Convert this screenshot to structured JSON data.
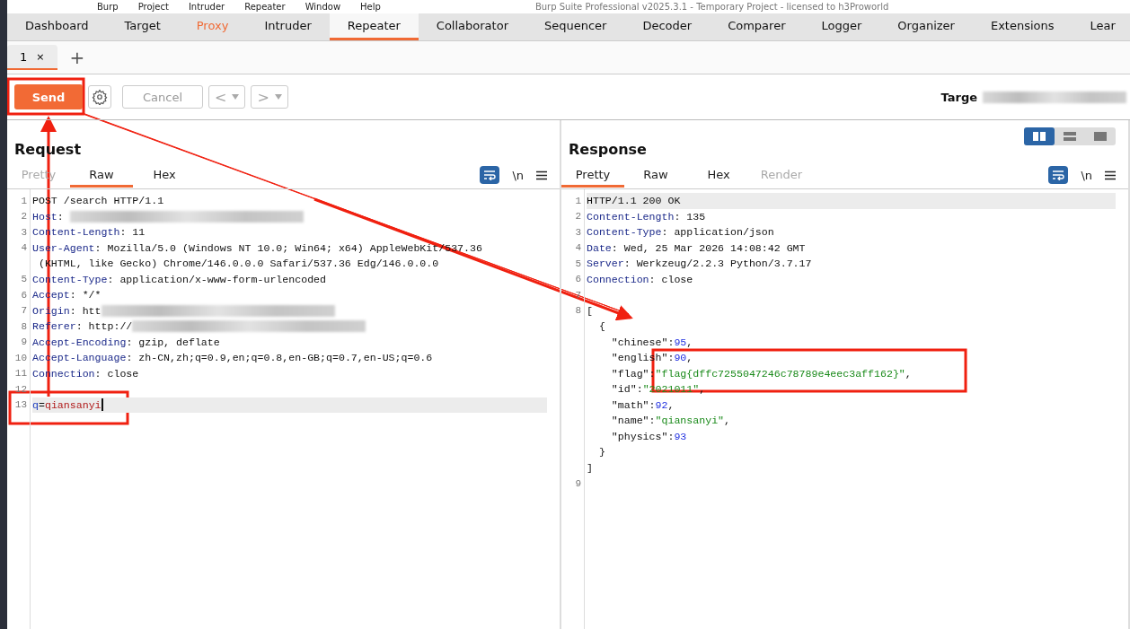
{
  "menu_bar": {
    "items": [
      "Burp",
      "Project",
      "Intruder",
      "Repeater",
      "Window",
      "Help"
    ],
    "title": "Burp Suite Professional v2025.3.1 - Temporary Project - licensed to h3Proworld"
  },
  "tabs": [
    {
      "label": "Dashboard",
      "selected": false,
      "highlighted": false
    },
    {
      "label": "Target",
      "selected": false,
      "highlighted": false
    },
    {
      "label": "Proxy",
      "selected": false,
      "highlighted": true
    },
    {
      "label": "Intruder",
      "selected": false,
      "highlighted": false
    },
    {
      "label": "Repeater",
      "selected": true,
      "highlighted": false
    },
    {
      "label": "Collaborator",
      "selected": false,
      "highlighted": false
    },
    {
      "label": "Sequencer",
      "selected": false,
      "highlighted": false
    },
    {
      "label": "Decoder",
      "selected": false,
      "highlighted": false
    },
    {
      "label": "Comparer",
      "selected": false,
      "highlighted": false
    },
    {
      "label": "Logger",
      "selected": false,
      "highlighted": false
    },
    {
      "label": "Organizer",
      "selected": false,
      "highlighted": false
    },
    {
      "label": "Extensions",
      "selected": false,
      "highlighted": false
    },
    {
      "label": "Lear",
      "selected": false,
      "highlighted": false
    }
  ],
  "repeater_tabs": [
    {
      "label": "1",
      "close": "×",
      "selected": true
    }
  ],
  "add_tab": "+",
  "toolbar": {
    "send": "Send",
    "cancel": "Cancel",
    "back": "<",
    "forward": ">",
    "target_label": "Targe"
  },
  "layout_buttons": [
    {
      "selected": true
    },
    {
      "selected": false
    },
    {
      "selected": false
    }
  ],
  "request": {
    "title": "Request",
    "view_tabs": [
      {
        "label": "Pretty",
        "selected": false,
        "disabled": true
      },
      {
        "label": "Raw",
        "selected": true,
        "disabled": false
      },
      {
        "label": "Hex",
        "selected": false,
        "disabled": false
      }
    ],
    "newline": "\\n",
    "lines": [
      {
        "number": "1",
        "highlighted": false,
        "tokens": [
          {
            "kind": "plain",
            "text": "POST /search HTTP/1.1"
          }
        ]
      },
      {
        "number": "2",
        "highlighted": false,
        "tokens": [
          {
            "kind": "name",
            "text": "Host"
          },
          {
            "kind": "plain",
            "text": ": "
          },
          {
            "kind": "redacted"
          }
        ]
      },
      {
        "number": "3",
        "highlighted": false,
        "tokens": [
          {
            "kind": "name",
            "text": "Content-Length"
          },
          {
            "kind": "plain",
            "text": ": 11"
          }
        ]
      },
      {
        "number": "4",
        "highlighted": false,
        "tokens": [
          {
            "kind": "name",
            "text": "User-Agent"
          },
          {
            "kind": "plain",
            "text": ": Mozilla/5.0 (Windows NT 10.0; Win64; x64) AppleWebKit/537.36"
          }
        ]
      },
      {
        "highlighted": false,
        "tokens": [
          {
            "kind": "plain",
            "text": " (KHTML, like Gecko) Chrome/146.0.0.0 Safari/537.36 Edg/146.0.0.0"
          }
        ]
      },
      {
        "number": "5",
        "highlighted": false,
        "tokens": [
          {
            "kind": "name",
            "text": "Content-Type"
          },
          {
            "kind": "plain",
            "text": ": application/x-www-form-urlencoded"
          }
        ]
      },
      {
        "number": "6",
        "highlighted": false,
        "tokens": [
          {
            "kind": "name",
            "text": "Accept"
          },
          {
            "kind": "plain",
            "text": ": */*"
          }
        ]
      },
      {
        "number": "7",
        "highlighted": false,
        "tokens": [
          {
            "kind": "name",
            "text": "Origin"
          },
          {
            "kind": "plain",
            "text": ": htt"
          },
          {
            "kind": "redacted"
          }
        ]
      },
      {
        "number": "8",
        "highlighted": false,
        "tokens": [
          {
            "kind": "name",
            "text": "Referer"
          },
          {
            "kind": "plain",
            "text": ": http://"
          },
          {
            "kind": "redacted"
          }
        ]
      },
      {
        "number": "9",
        "highlighted": false,
        "tokens": [
          {
            "kind": "name",
            "text": "Accept-Encoding"
          },
          {
            "kind": "plain",
            "text": ": gzip, deflate"
          }
        ]
      },
      {
        "number": "10",
        "highlighted": false,
        "tokens": [
          {
            "kind": "name",
            "text": "Accept-Language"
          },
          {
            "kind": "plain",
            "text": ": zh-CN,zh;q=0.9,en;q=0.8,en-GB;q=0.7,en-US;q=0.6"
          }
        ]
      },
      {
        "number": "11",
        "highlighted": false,
        "tokens": [
          {
            "kind": "name",
            "text": "Connection"
          },
          {
            "kind": "plain",
            "text": ": close"
          }
        ]
      },
      {
        "number": "12",
        "highlighted": false
      },
      {
        "number": "13",
        "highlighted": true,
        "tokens": [
          {
            "kind": "param",
            "text": "q"
          },
          {
            "kind": "plain",
            "text": "="
          },
          {
            "kind": "param_value",
            "text": "qiansanyi"
          }
        ]
      }
    ]
  },
  "response": {
    "title": "Response",
    "view_tabs": [
      {
        "label": "Pretty",
        "selected": true,
        "disabled": false
      },
      {
        "label": "Raw",
        "selected": false,
        "disabled": false
      },
      {
        "label": "Hex",
        "selected": false,
        "disabled": false
      },
      {
        "label": "Render",
        "selected": false,
        "disabled": true
      }
    ],
    "newline": "\\n",
    "lines": [
      {
        "number": "1",
        "highlighted": true,
        "tokens": [
          {
            "kind": "plain",
            "text": "HTTP/1.1 200 OK"
          }
        ]
      },
      {
        "number": "2",
        "highlighted": false,
        "tokens": [
          {
            "kind": "name",
            "text": "Content-Length"
          },
          {
            "kind": "plain",
            "text": ": 135"
          }
        ]
      },
      {
        "number": "3",
        "highlighted": false,
        "tokens": [
          {
            "kind": "name",
            "text": "Content-Type"
          },
          {
            "kind": "plain",
            "text": ": application/json"
          }
        ]
      },
      {
        "number": "4",
        "highlighted": false,
        "tokens": [
          {
            "kind": "name",
            "text": "Date"
          },
          {
            "kind": "plain",
            "text": ": Wed, 25 Mar 2026 14:08:42 GMT"
          }
        ]
      },
      {
        "number": "5",
        "highlighted": false,
        "tokens": [
          {
            "kind": "name",
            "text": "Server"
          },
          {
            "kind": "plain",
            "text": ": Werkzeug/2.2.3 Python/3.7.17"
          }
        ]
      },
      {
        "number": "6",
        "highlighted": false,
        "tokens": [
          {
            "kind": "name",
            "text": "Connection"
          },
          {
            "kind": "plain",
            "text": ": close"
          }
        ]
      },
      {
        "number": "7",
        "highlighted": false
      },
      {
        "number": "8",
        "highlighted": false,
        "tokens": [
          {
            "kind": "plain",
            "text": "["
          }
        ]
      },
      {
        "highlighted": false,
        "tokens": [
          {
            "kind": "plain",
            "text": "  {"
          }
        ]
      },
      {
        "highlighted": false,
        "tokens": [
          {
            "kind": "plain",
            "text": "    \"chinese\":"
          },
          {
            "kind": "num",
            "text": "95"
          },
          {
            "kind": "plain",
            "text": ","
          }
        ]
      },
      {
        "highlighted": false,
        "tokens": [
          {
            "kind": "plain",
            "text": "    \"english\":"
          },
          {
            "kind": "num",
            "text": "90"
          },
          {
            "kind": "plain",
            "text": ","
          }
        ]
      },
      {
        "highlighted": false,
        "tokens": [
          {
            "kind": "plain",
            "text": "    \"flag\":"
          },
          {
            "kind": "str",
            "text": "\"flag{dffc7255047246c78789e4eec3aff162}\""
          },
          {
            "kind": "plain",
            "text": ","
          }
        ]
      },
      {
        "highlighted": false,
        "tokens": [
          {
            "kind": "plain",
            "text": "    \"id\":"
          },
          {
            "kind": "str",
            "text": "\"2021011\""
          },
          {
            "kind": "plain",
            "text": ","
          }
        ]
      },
      {
        "highlighted": false,
        "tokens": [
          {
            "kind": "plain",
            "text": "    \"math\":"
          },
          {
            "kind": "num",
            "text": "92"
          },
          {
            "kind": "plain",
            "text": ","
          }
        ]
      },
      {
        "highlighted": false,
        "tokens": [
          {
            "kind": "plain",
            "text": "    \"name\":"
          },
          {
            "kind": "str",
            "text": "\"qiansanyi\""
          },
          {
            "kind": "plain",
            "text": ","
          }
        ]
      },
      {
        "highlighted": false,
        "tokens": [
          {
            "kind": "plain",
            "text": "    \"physics\":"
          },
          {
            "kind": "num",
            "text": "93"
          }
        ]
      },
      {
        "highlighted": false,
        "tokens": [
          {
            "kind": "plain",
            "text": "  }"
          }
        ]
      },
      {
        "highlighted": false,
        "tokens": [
          {
            "kind": "plain",
            "text": "]"
          }
        ]
      },
      {
        "number": "9",
        "highlighted": false
      }
    ]
  }
}
